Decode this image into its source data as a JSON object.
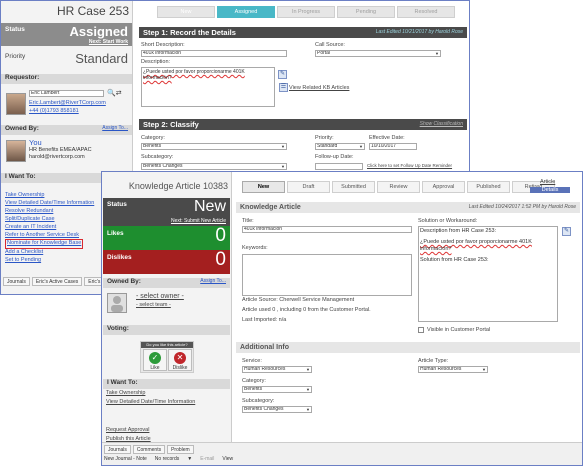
{
  "case": {
    "title": "HR Case 253",
    "status_label": "Status",
    "status_value": "Assigned",
    "next_step": "Next: Start Work",
    "priority_label": "Priority",
    "priority_value": "Standard",
    "requestor_label": "Requestor:",
    "requestor_name": "Eric Lambert",
    "requestor_email": "Eric.Lambert@RiverTCorp.com",
    "requestor_phone": "+44 (0)1793 858181",
    "owned_by_label": "Owned By:",
    "assign_to": "Assign To...",
    "owner_name": "You",
    "owner_role": "HR Benefits EMEA/APAC",
    "owner_email": "harold@rivertcorp.com",
    "i_want_label": "I Want To:",
    "actions": [
      "Take Ownership",
      "View Detailed Date/Time Information",
      "Resolve Redundant",
      "Split/Duplicate Case",
      "Create an IT Incident",
      "Refer to Another Service Desk",
      "Nominate for Knowledge Base",
      "Add a Checklist",
      "Set to Pending"
    ],
    "tabs": [
      "New",
      "Assigned",
      "In Progress",
      "Pending",
      "Resolved"
    ],
    "step1_title": "Step 1:  Record the Details",
    "last_edited": "Last Edited 10/21/2017 by Harold Rose",
    "short_desc_label": "Short Description:",
    "short_desc_value": "401k información",
    "call_source_label": "Call Source:",
    "call_source_value": "Portal",
    "description_label": "Description:",
    "description_value": "¿Puede usted por favor proporcionarme 401K información?",
    "view_related": "View Related KB Articles",
    "step2_title": "Step 2:  Classify",
    "step2_link": "Show Classification",
    "category_label": "Category:",
    "category_value": "Benefits",
    "priority_field_label": "Priority:",
    "priority_field_value": "Standard",
    "effective_date_label": "Effective Date:",
    "effective_date_value": "10/10/2017",
    "subcategory_label": "Subcategory:",
    "subcategory_value": "Benefits Changes",
    "followup_label": "Follow-up Date:",
    "followup_link": "Click here to set Follow Up Date Reminder",
    "bottom_tabs": [
      "Journals",
      "Eric's Active Cases",
      "Eric's"
    ]
  },
  "kb": {
    "title": "Knowledge Article 10383",
    "status_label": "Status",
    "status_value": "New",
    "next_step": "Next: Submit New Article",
    "likes_label": "Likes",
    "likes_value": "0",
    "dislikes_label": "Dislikes",
    "dislikes_value": "0",
    "owned_by_label": "Owned By:",
    "assign_to": "Assign To...",
    "select_owner": "- select owner -",
    "select_team": "- select team -",
    "voting_label": "Voting:",
    "vote_question": "Do you like this article?",
    "like_btn": "Like",
    "dislike_btn": "Dislike",
    "i_want_label": "I Want To:",
    "actions": [
      "Take Ownership",
      "View Detailed Date/Time Information",
      "Request Approval",
      "Publish this Article"
    ],
    "tabs": [
      "New",
      "Draft",
      "Submitted",
      "Review",
      "Approval",
      "Published",
      "Retired"
    ],
    "top_links": [
      "Article",
      "Details"
    ],
    "section_title": "Knowledge Article",
    "last_edited": "Last Edited 10/24/2017 1:52 PM by Harold Rose",
    "title_label": "Title:",
    "title_value": "401k información",
    "keywords_label": "Keywords:",
    "solution_label": "Solution or Workaround:",
    "solution_line1": "Description from HR Case 253:",
    "solution_line2": "¿Puede usted por favor proporcionarme 401K información?",
    "solution_line3": "Solution from HR Case 253:",
    "article_source": "Article Source:  Cherwell Service Management",
    "article_used": "Article used 0 , including 0  from the Customer Portal.",
    "last_imported": "Last Imported:  n/a",
    "visible_portal": "Visible in Customer Portal",
    "additional_info": "Additional Info",
    "service_label": "Service:",
    "service_value": "Human Resources",
    "article_type_label": "Article Type:",
    "article_type_value": "Human Resources",
    "category_label": "Category:",
    "category_value": "Benefits",
    "subcategory_label": "Subcategory:",
    "subcategory_value": "Benefits Changes",
    "bottom_tabs": [
      "Journals",
      "Comments",
      "Problem"
    ],
    "toolbar": [
      "New Journal - Note",
      "No records",
      "E-mail",
      "View"
    ]
  },
  "colors": {
    "accent_teal": "#49b8c7",
    "status_dark": "#4a4a4a",
    "likes_green": "#1e8e2f",
    "dislikes_red": "#a41f1f",
    "link_blue": "#2a56c6",
    "highlight_red": "#d9292f"
  }
}
